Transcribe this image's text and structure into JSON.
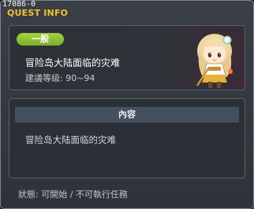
{
  "quest": {
    "id": "17086-0",
    "window_title": "QUEST INFO",
    "category_badge": "一般",
    "name": "冒险岛大陆面临的灾难",
    "level_label": "建議等级: 90~94"
  },
  "content": {
    "header": "內容",
    "text": "冒险岛大陆面临的灾难"
  },
  "status": {
    "text": "狀態: 可開始 / 不可執行任務"
  },
  "icons": {
    "npc": "npc-portrait-icon"
  },
  "colors": {
    "title": "#f3c233",
    "badge": "#8cc032",
    "header_bar": "#44505d"
  }
}
